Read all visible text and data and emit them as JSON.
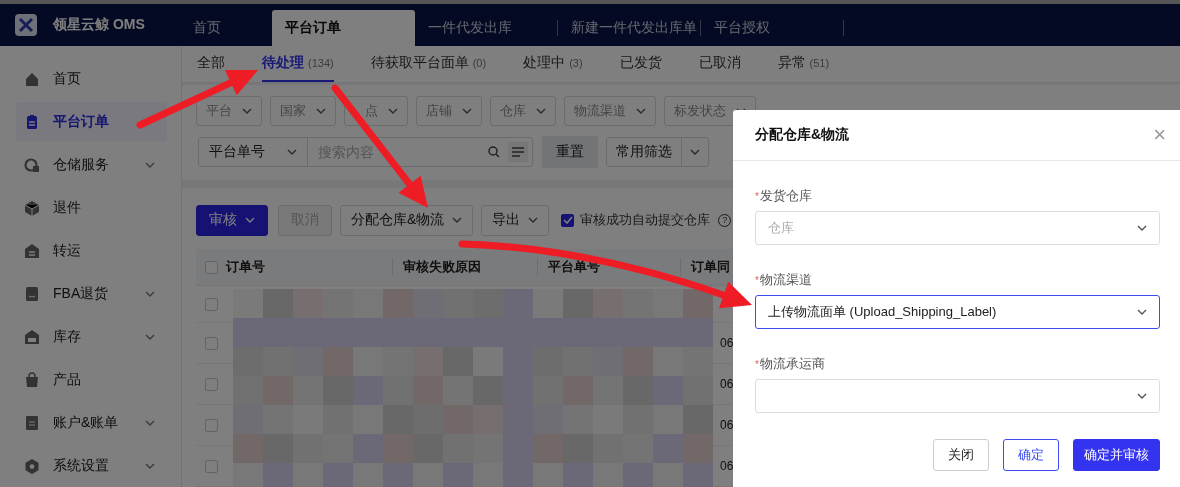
{
  "app": {
    "logo_text": "领星云鲸 OMS"
  },
  "top_tabs": [
    {
      "label": "首页",
      "selected": false
    },
    {
      "label": "平台订单",
      "selected": true
    },
    {
      "label": "一件代发出库",
      "selected": false
    },
    {
      "label": "新建一件代发出库单",
      "selected": false
    },
    {
      "label": "平台授权",
      "selected": false
    }
  ],
  "sidebar": {
    "items": [
      {
        "label": "首页",
        "selected": false,
        "expandable": false
      },
      {
        "label": "平台订单",
        "selected": true,
        "expandable": false
      },
      {
        "label": "仓储服务",
        "selected": false,
        "expandable": true
      },
      {
        "label": "退件",
        "selected": false,
        "expandable": false
      },
      {
        "label": "转运",
        "selected": false,
        "expandable": false
      },
      {
        "label": "FBA退货",
        "selected": false,
        "expandable": true
      },
      {
        "label": "库存",
        "selected": false,
        "expandable": true
      },
      {
        "label": "产品",
        "selected": false,
        "expandable": false
      },
      {
        "label": "账户&账单",
        "selected": false,
        "expandable": true
      },
      {
        "label": "系统设置",
        "selected": false,
        "expandable": true
      }
    ]
  },
  "status_tabs": [
    {
      "label": "全部",
      "selected": false
    },
    {
      "label": "待处理",
      "count": "(134)",
      "selected": true
    },
    {
      "label": "待获取平台面单",
      "count": "(0)",
      "selected": false
    },
    {
      "label": "处理中",
      "count": "(3)",
      "selected": false
    },
    {
      "label": "已发货",
      "selected": false
    },
    {
      "label": "已取消",
      "selected": false
    },
    {
      "label": "异常",
      "count": "(51)",
      "selected": false
    }
  ],
  "filters": [
    "平台",
    "国家",
    "点",
    "店铺",
    "仓库",
    "物流渠道",
    "标发状态"
  ],
  "search": {
    "field": "平台单号",
    "placeholder": "搜索内容",
    "reset": "重置",
    "saved_filters": "常用筛选"
  },
  "toolbar": {
    "buttons": [
      {
        "label": "审核",
        "kind": "primary",
        "caret": true
      },
      {
        "label": "取消",
        "kind": "disabled",
        "caret": false
      },
      {
        "label": "分配仓库&物流",
        "kind": "default",
        "caret": true
      },
      {
        "label": "导出",
        "kind": "default",
        "caret": true
      }
    ],
    "auto_submit": {
      "label": "审核成功自动提交仓库",
      "checked": true,
      "help": "?"
    }
  },
  "table": {
    "select_all": {
      "checked": false
    },
    "columns": [
      "订单号",
      "审核失败原因",
      "平台单号",
      "订单同"
    ],
    "rows": [
      {
        "checked": false
      },
      {
        "checked": false,
        "column_4": "06"
      },
      {
        "checked": false,
        "column_4": "06"
      },
      {
        "checked": false,
        "column_4": "06"
      },
      {
        "checked": false,
        "column_4": "06"
      }
    ]
  },
  "dialog": {
    "title": "分配仓库&物流",
    "close": "×",
    "fields": [
      {
        "label": "发货仓库",
        "required_mark": "*",
        "placeholder": "仓库",
        "focused": false
      },
      {
        "label": "物流渠道",
        "required_mark": "*",
        "value": "上传物流面单 (Upload_Shipping_Label)",
        "focused": true
      },
      {
        "label": "物流承运商",
        "required_mark": "*",
        "focused": false
      }
    ],
    "buttons": [
      {
        "label": "关闭",
        "kind": "default"
      },
      {
        "label": "确定",
        "kind": "outline"
      },
      {
        "label": "确定并审核",
        "kind": "primary"
      }
    ]
  }
}
